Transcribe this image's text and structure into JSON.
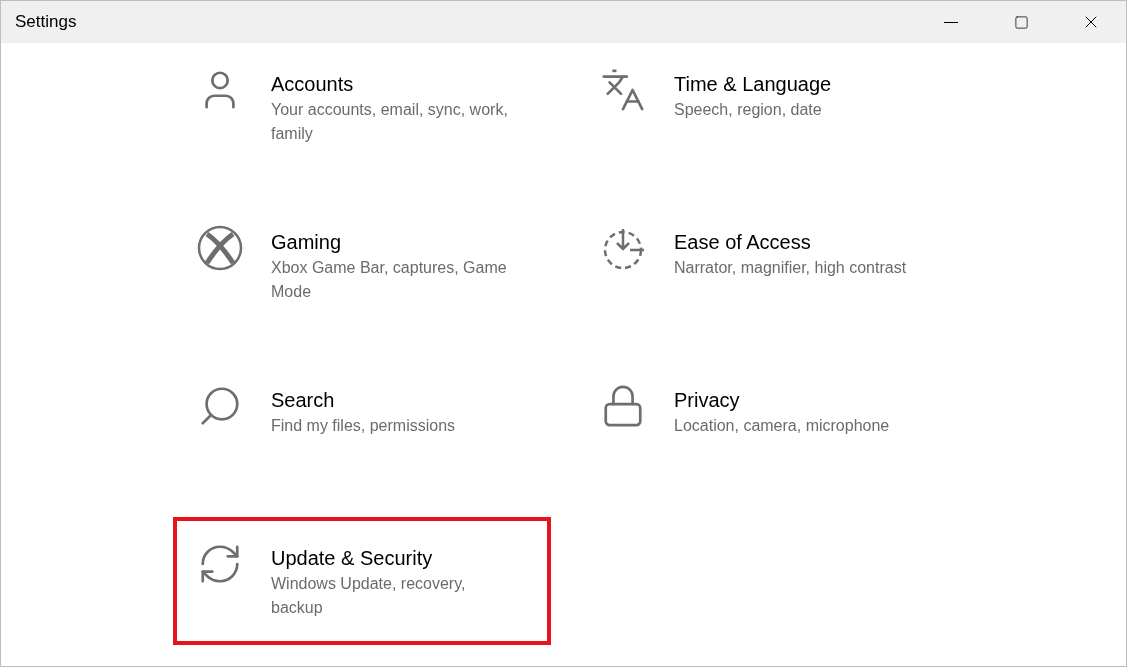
{
  "window": {
    "title": "Settings"
  },
  "items": [
    {
      "kind": "person",
      "title": "Accounts",
      "description": "Your accounts, email, sync, work, family",
      "highlighted": false
    },
    {
      "kind": "language",
      "title": "Time & Language",
      "description": "Speech, region, date",
      "highlighted": false
    },
    {
      "kind": "gaming",
      "title": "Gaming",
      "description": "Xbox Game Bar, captures, Game Mode",
      "highlighted": false
    },
    {
      "kind": "access",
      "title": "Ease of Access",
      "description": "Narrator, magnifier, high contrast",
      "highlighted": false
    },
    {
      "kind": "search",
      "title": "Search",
      "description": "Find my files, permissions",
      "highlighted": false
    },
    {
      "kind": "privacy",
      "title": "Privacy",
      "description": "Location, camera, microphone",
      "highlighted": false
    },
    {
      "kind": "update",
      "title": "Update & Security",
      "description": "Windows Update, recovery, backup",
      "highlighted": true
    }
  ]
}
